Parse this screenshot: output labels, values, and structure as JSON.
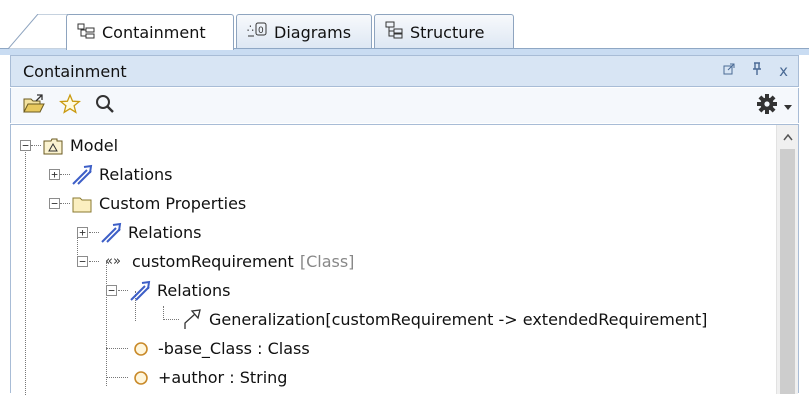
{
  "tabs": [
    {
      "label": "Containment",
      "icon": "containment-tree-icon",
      "active": true
    },
    {
      "label": "Diagrams",
      "icon": "diagrams-icon",
      "active": false
    },
    {
      "label": "Structure",
      "icon": "structure-icon",
      "active": false
    }
  ],
  "panel": {
    "title": "Containment",
    "controls": [
      "undock-icon",
      "pin-icon",
      "close-icon"
    ],
    "close_glyph": "x"
  },
  "toolbar": {
    "left_icons": [
      "open-folder-icon",
      "favorite-star-icon",
      "search-icon"
    ],
    "right_icons": [
      "gear-icon",
      "dropdown-arrow-icon"
    ]
  },
  "tree": [
    {
      "label": "Model",
      "type": "",
      "icon": "model-package-icon",
      "toggle": "−"
    },
    {
      "label": "Relations",
      "type": "",
      "icon": "relations-icon",
      "toggle": "+"
    },
    {
      "label": "Custom Properties",
      "type": "",
      "icon": "folder-icon",
      "toggle": "−"
    },
    {
      "label": "Relations",
      "type": "",
      "icon": "relations-icon",
      "toggle": "+"
    },
    {
      "label": "customRequirement",
      "type": "[Class]",
      "icon": "stereotype-icon",
      "icon_glyph": "«»",
      "toggle": "−"
    },
    {
      "label": "Relations",
      "type": "",
      "icon": "relations-icon",
      "toggle": "−"
    },
    {
      "label": "Generalization[customRequirement -> extendedRequirement]",
      "type": "",
      "icon": "generalization-icon",
      "toggle": ""
    },
    {
      "label": "-base_Class",
      "type": " : Class",
      "icon": "property-icon",
      "toggle": ""
    },
    {
      "label": "+author",
      "type": " : String",
      "icon": "property-icon",
      "toggle": ""
    }
  ],
  "colors": {
    "tab_border": "#8ea4bf",
    "header_bg": "#d8e5f4",
    "relations_icon": "#3d5fc7",
    "folder_icon": "#e9d28a",
    "property_icon": "#c98a2a"
  }
}
